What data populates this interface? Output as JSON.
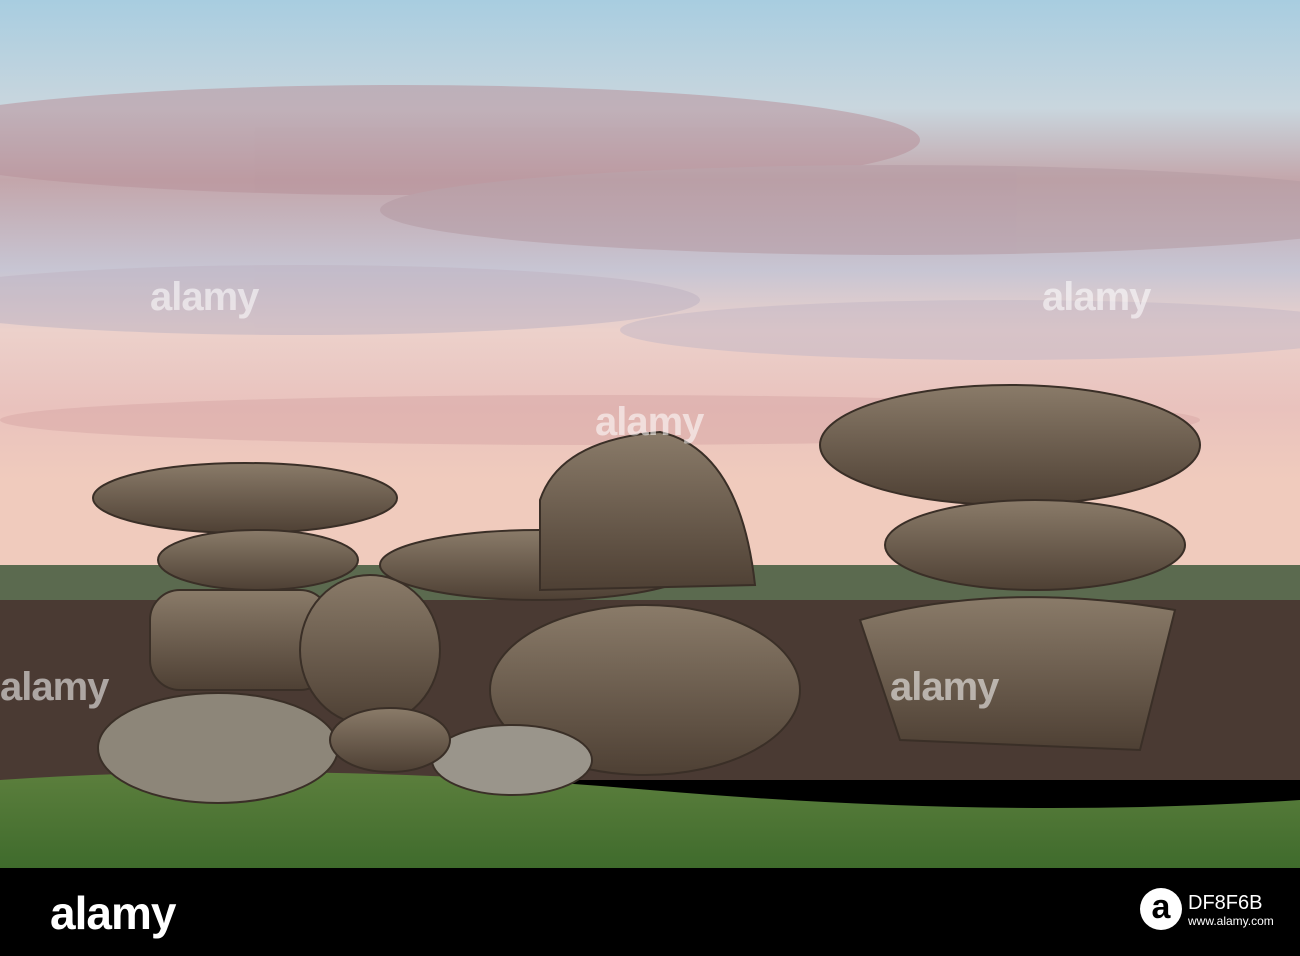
{
  "watermark": {
    "text": "alamy"
  },
  "footer": {
    "logo": "alamy",
    "logo_mark": "a",
    "image_id": "DF8F6B",
    "site": "www.alamy.com"
  },
  "colors": {
    "sky_top": "#a9cfe0",
    "sky_pink": "#e6b5b0",
    "horizon": "#efc7b8",
    "rock": "#6b5c4b",
    "grass": "#4f7a34",
    "bar": "#000000"
  }
}
